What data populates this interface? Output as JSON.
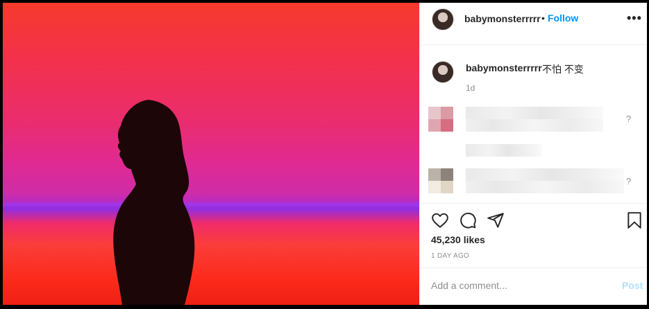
{
  "post": {
    "username": "babymonsterrrrr",
    "follow_label": "Follow",
    "dot": "•",
    "more_label": "•••",
    "caption_text": "不怕 不变",
    "caption_age": "1d",
    "likes": "45,230 likes",
    "date": "1 DAY AGO",
    "comment_placeholder": "Add a comment...",
    "post_label": "Post"
  },
  "comments": [
    {
      "reply_indicator": "?"
    },
    {
      "reply_indicator": "?"
    }
  ],
  "icons": {
    "like": "heart-icon",
    "comment": "comment-bubble-icon",
    "share": "paper-plane-icon",
    "save": "bookmark-icon",
    "more": "more-options-icon"
  },
  "colors": {
    "follow": "#0095f6",
    "post_disabled": "#b2dffc",
    "text": "#262626",
    "muted": "#8e8e8e"
  }
}
